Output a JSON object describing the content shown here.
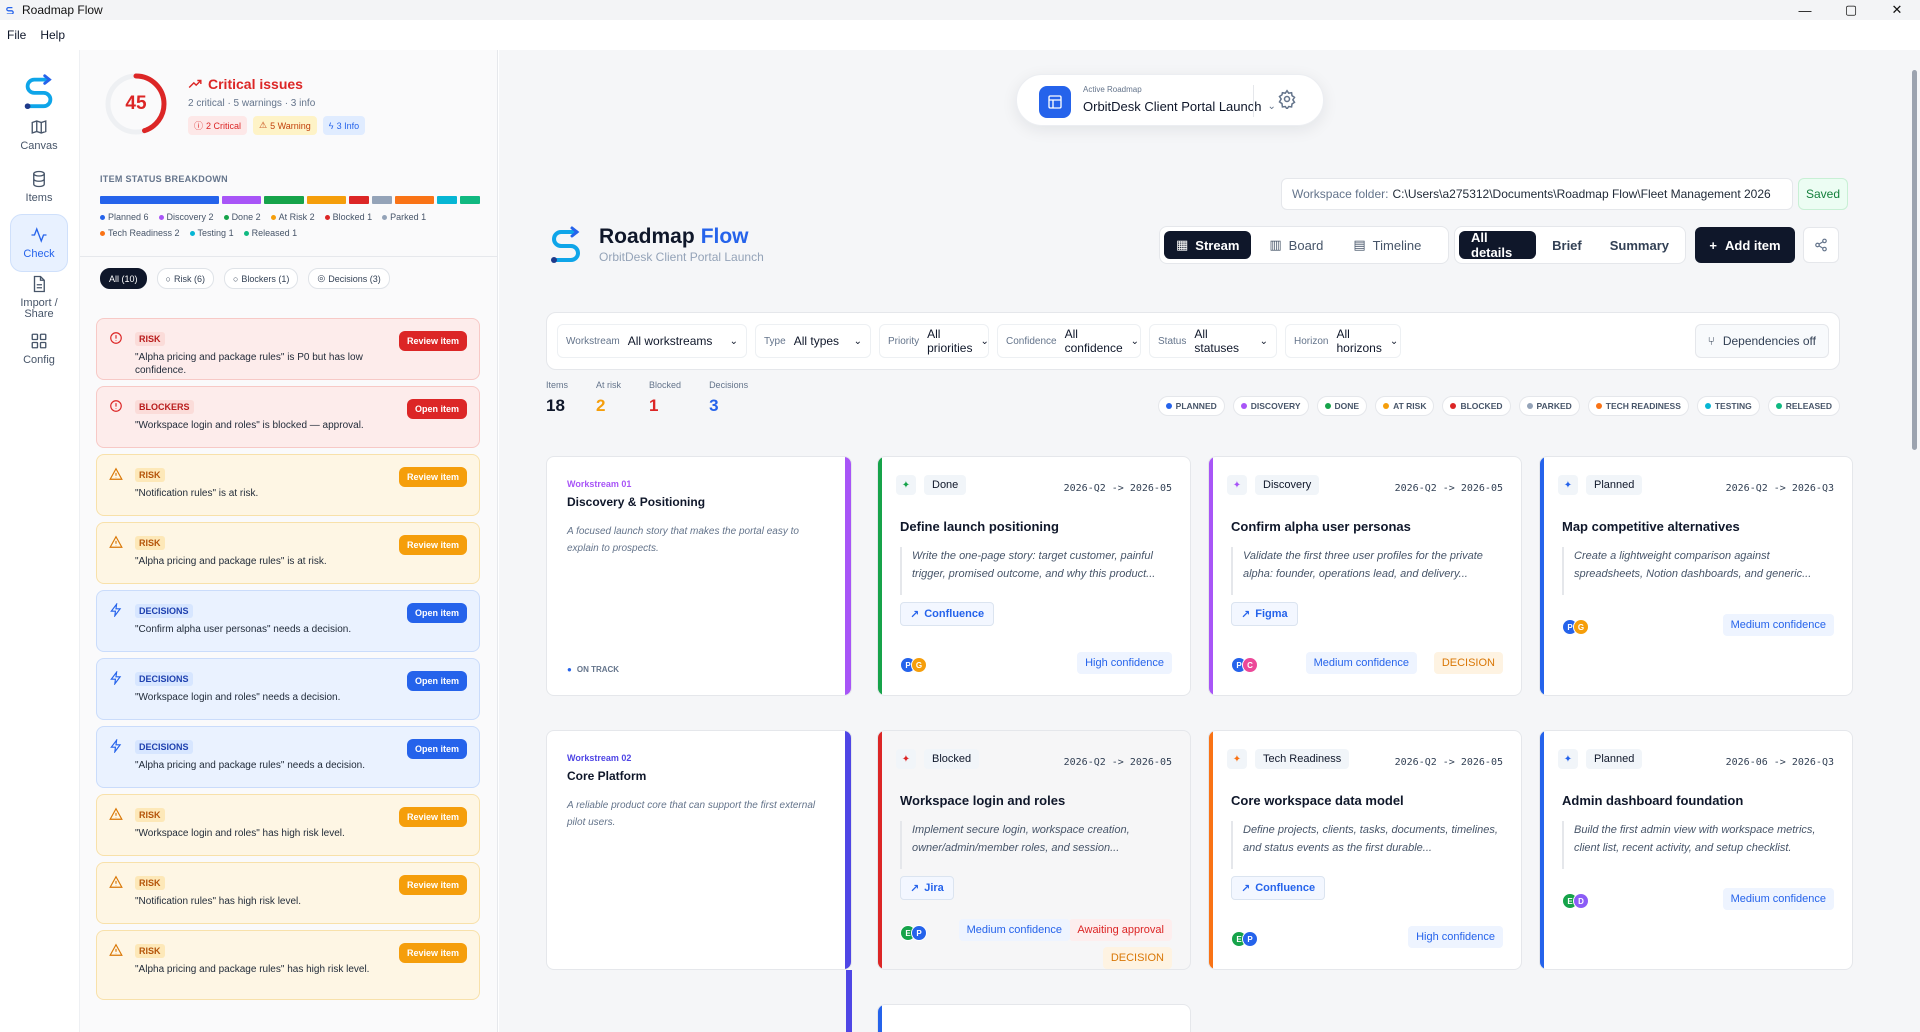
{
  "window": {
    "title": "Roadmap Flow",
    "min": "—",
    "max": "▢",
    "close": "✕"
  },
  "menu": [
    "File",
    "Help"
  ],
  "rail": [
    {
      "label": "Canvas",
      "icon": "map-icon"
    },
    {
      "label": "Items",
      "icon": "database-icon"
    },
    {
      "label": "Check",
      "icon": "activity-icon",
      "active": true
    },
    {
      "label": "Import / Share",
      "icon": "file-icon"
    },
    {
      "label": "Config",
      "icon": "grid-icon"
    }
  ],
  "check": {
    "score": "45",
    "score_fraction": 0.45,
    "title": "Critical issues",
    "subtitle": "2 critical · 5 warnings · 3 info",
    "pills": {
      "critical": "2 Critical",
      "warning": "5 Warning",
      "info": "3 Info"
    },
    "breakdown_label": "ITEM STATUS BREAKDOWN",
    "breakdown": [
      {
        "label": "Planned 6",
        "count": 6,
        "color": "#2563eb"
      },
      {
        "label": "Discovery 2",
        "count": 2,
        "color": "#a855f7"
      },
      {
        "label": "Done 2",
        "count": 2,
        "color": "#16a34a"
      },
      {
        "label": "At Risk 2",
        "count": 2,
        "color": "#f59e0b"
      },
      {
        "label": "Blocked 1",
        "count": 1,
        "color": "#dc2626"
      },
      {
        "label": "Parked 1",
        "count": 1,
        "color": "#94a3b8"
      },
      {
        "label": "Tech Readiness 2",
        "count": 2,
        "color": "#f97316"
      },
      {
        "label": "Testing 1",
        "count": 1,
        "color": "#06b6d4"
      },
      {
        "label": "Released 1",
        "count": 1,
        "color": "#10b981"
      }
    ],
    "tabs": [
      "All (10)",
      "Risk (6)",
      "Blockers (1)",
      "Decisions (3)"
    ],
    "issues": [
      {
        "kind": "red",
        "tag": "RISK",
        "text": "\"Alpha pricing and package rules\" is P0 but has low confidence.",
        "action": "Review item"
      },
      {
        "kind": "red",
        "tag": "BLOCKERS",
        "text": "\"Workspace login and roles\" is blocked — approval.",
        "action": "Open item"
      },
      {
        "kind": "amber",
        "tag": "RISK",
        "text": "\"Notification rules\" is at risk.",
        "action": "Review item"
      },
      {
        "kind": "amber",
        "tag": "RISK",
        "text": "\"Alpha pricing and package rules\" is at risk.",
        "action": "Review item"
      },
      {
        "kind": "blue",
        "tag": "DECISIONS",
        "text": "\"Confirm alpha user personas\" needs a decision.",
        "action": "Open item"
      },
      {
        "kind": "blue",
        "tag": "DECISIONS",
        "text": "\"Workspace login and roles\" needs a decision.",
        "action": "Open item"
      },
      {
        "kind": "blue",
        "tag": "DECISIONS",
        "text": "\"Alpha pricing and package rules\" needs a decision.",
        "action": "Open item"
      },
      {
        "kind": "amber",
        "tag": "RISK",
        "text": "\"Workspace login and roles\" has high risk level.",
        "action": "Review item"
      },
      {
        "kind": "amber",
        "tag": "RISK",
        "text": "\"Notification rules\" has high risk level.",
        "action": "Review item"
      },
      {
        "kind": "amber",
        "tag": "RISK",
        "text": "\"Alpha pricing and package rules\" has high risk level.",
        "action": "Review item"
      }
    ]
  },
  "roadmap_selector": {
    "label": "Active Roadmap",
    "name": "OrbitDesk Client Portal Launch"
  },
  "workspace": {
    "label": "Workspace folder:",
    "path": "C:\\Users\\a275312\\Documents\\Roadmap Flow\\Fleet Management 2026",
    "status": "Saved"
  },
  "brand": {
    "title": "Roadmap",
    "title_accent": "Flow",
    "subtitle": "OrbitDesk Client Portal Launch"
  },
  "views": {
    "stream": "Stream",
    "board": "Board",
    "timeline": "Timeline"
  },
  "details": {
    "all": "All details",
    "brief": "Brief",
    "summary": "Summary"
  },
  "add_item": "Add item",
  "filters": [
    {
      "key": "Workstream",
      "value": "All workstreams"
    },
    {
      "key": "Type",
      "value": "All types"
    },
    {
      "key": "Priority",
      "value": "All priorities"
    },
    {
      "key": "Confidence",
      "value": "All confidence"
    },
    {
      "key": "Status",
      "value": "All statuses"
    },
    {
      "key": "Horizon",
      "value": "All horizons"
    }
  ],
  "dependencies": "Dependencies off",
  "stats": [
    {
      "label": "Items",
      "value": "18",
      "color": "#0f172a"
    },
    {
      "label": "At risk",
      "value": "2",
      "color": "#f59e0b"
    },
    {
      "label": "Blocked",
      "value": "1",
      "color": "#dc2626"
    },
    {
      "label": "Decisions",
      "value": "3",
      "color": "#2563eb"
    }
  ],
  "legend_chips": [
    {
      "label": "PLANNED",
      "color": "#2563eb"
    },
    {
      "label": "DISCOVERY",
      "color": "#a855f7"
    },
    {
      "label": "DONE",
      "color": "#16a34a"
    },
    {
      "label": "AT RISK",
      "color": "#f59e0b"
    },
    {
      "label": "BLOCKED",
      "color": "#dc2626"
    },
    {
      "label": "PARKED",
      "color": "#94a3b8"
    },
    {
      "label": "TECH READINESS",
      "color": "#f97316"
    },
    {
      "label": "TESTING",
      "color": "#06b6d4"
    },
    {
      "label": "RELEASED",
      "color": "#10b981"
    }
  ],
  "workstreams": [
    {
      "id": "Workstream 01",
      "title": "Discovery & Positioning",
      "desc": "A focused launch story that makes the portal easy to explain to prospects.",
      "status": "ON TRACK",
      "color": "#a855f7"
    },
    {
      "id": "Workstream 02",
      "title": "Core Platform",
      "desc": "A reliable product core that can support the first external pilot users.",
      "status": "",
      "color": "#4f46e5"
    }
  ],
  "cards": [
    {
      "type": "Done",
      "dates": "2026-Q2 -> 2026-05",
      "title": "Define launch positioning",
      "desc": "Write the one-page story: target customer, painful trigger, promised outcome, and why this product...",
      "link": "Confluence",
      "avatars": [
        "P",
        "G"
      ],
      "confidence": "High confidence",
      "color": "#16a34a"
    },
    {
      "type": "Discovery",
      "dates": "2026-Q2 -> 2026-05",
      "title": "Confirm alpha user personas",
      "desc": "Validate the first three user profiles for the private alpha: founder, operations lead, and delivery...",
      "link": "Figma",
      "avatars": [
        "P",
        "C"
      ],
      "confidence": "Medium confidence",
      "decision": "DECISION",
      "color": "#a855f7"
    },
    {
      "type": "Planned",
      "dates": "2026-Q2 -> 2026-Q3",
      "title": "Map competitive alternatives",
      "desc": "Create a lightweight comparison against spreadsheets, Notion dashboards, and generic...",
      "link": "",
      "avatars": [
        "P",
        "G"
      ],
      "confidence": "Medium confidence",
      "color": "#2563eb"
    },
    {
      "type": "Blocked",
      "dates": "2026-Q2 -> 2026-05",
      "title": "Workspace login and roles",
      "desc": "Implement secure login, workspace creation, owner/admin/member roles, and session...",
      "link": "Jira",
      "avatars": [
        "E",
        "P"
      ],
      "confidence": "Medium confidence",
      "awaiting": "Awaiting approval",
      "decision": "DECISION",
      "color": "#dc2626"
    },
    {
      "type": "Tech Readiness",
      "dates": "2026-Q2 -> 2026-05",
      "title": "Core workspace data model",
      "desc": "Define projects, clients, tasks, documents, timelines, and status events as the first durable...",
      "link": "Confluence",
      "avatars": [
        "E",
        "P"
      ],
      "confidence": "High confidence",
      "color": "#f97316"
    },
    {
      "type": "Planned",
      "dates": "2026-06 -> 2026-Q3",
      "title": "Admin dashboard foundation",
      "desc": "Build the first admin view with workspace metrics, client list, recent activity, and setup checklist.",
      "link": "",
      "avatars": [
        "E",
        "D"
      ],
      "confidence": "Medium confidence",
      "color": "#2563eb"
    }
  ]
}
